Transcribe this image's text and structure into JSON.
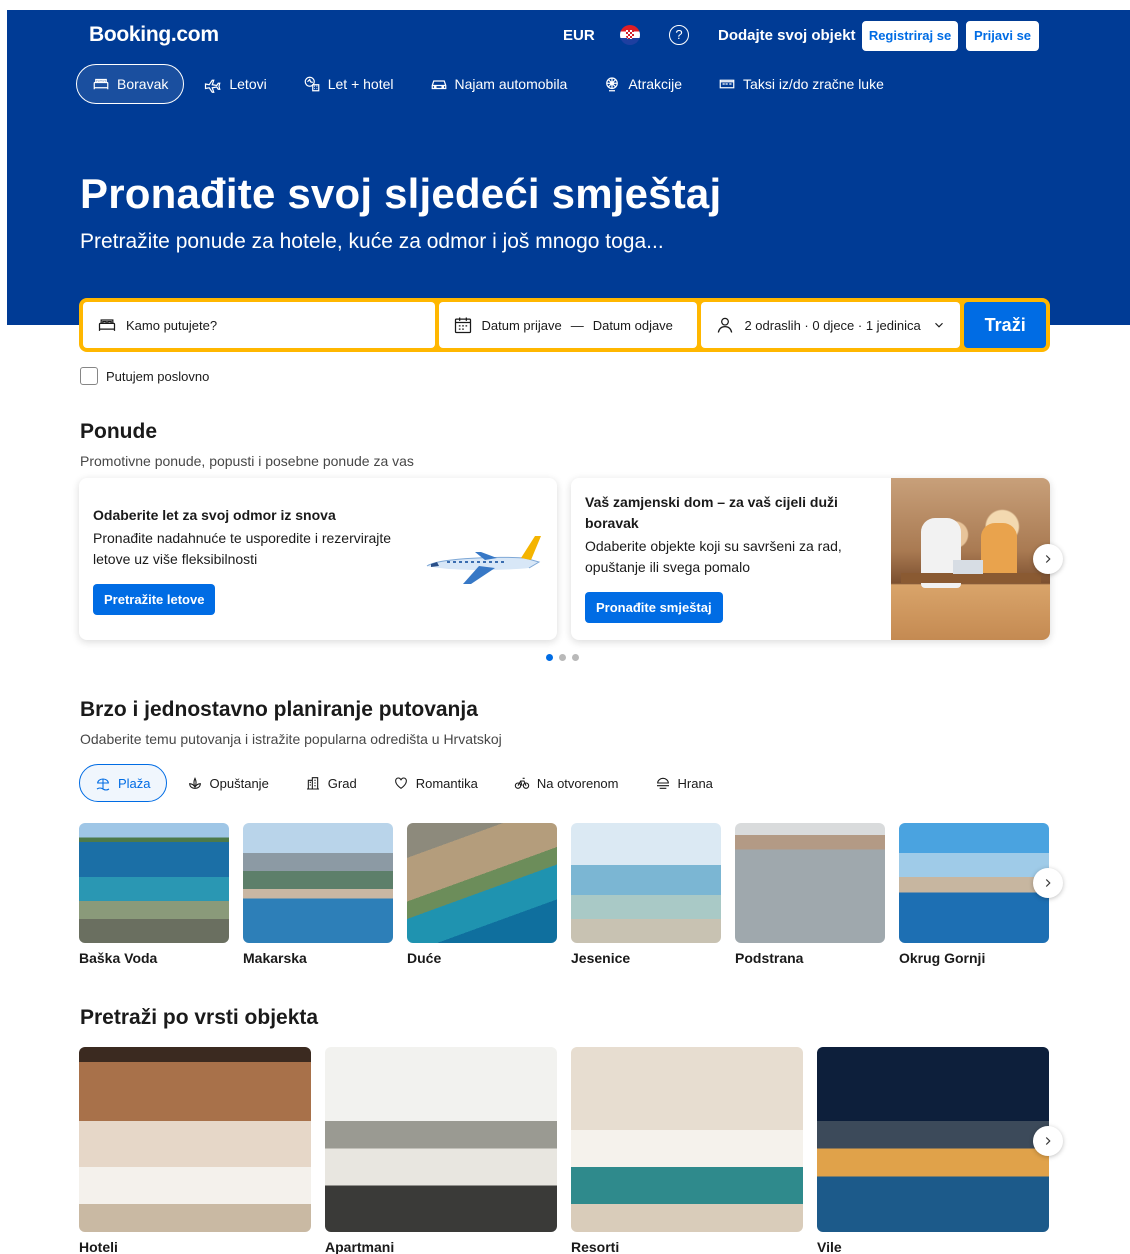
{
  "header": {
    "logo": "Booking.com",
    "currency": "EUR",
    "help": "?",
    "list_property": "Dodajte svoj objekt",
    "register": "Registriraj se",
    "login": "Prijavi se"
  },
  "nav": {
    "items": [
      {
        "label": "Boravak",
        "icon": "bed-icon",
        "active": true
      },
      {
        "label": "Letovi",
        "icon": "plane-icon"
      },
      {
        "label": "Let + hotel",
        "icon": "plane-hotel-icon"
      },
      {
        "label": "Najam automobila",
        "icon": "car-icon"
      },
      {
        "label": "Atrakcije",
        "icon": "attractions-icon"
      },
      {
        "label": "Taksi iz/do zračne luke",
        "icon": "taxi-icon"
      }
    ]
  },
  "hero": {
    "title": "Pronađite svoj sljedeći smještaj",
    "subtitle": "Pretražite ponude za hotele, kuće za odmor i još mnogo toga..."
  },
  "search": {
    "destination_placeholder": "Kamo putujete?",
    "checkin": "Datum prijave",
    "date_sep": "—",
    "checkout": "Datum odjave",
    "guests": "2 odraslih · 0 djece · 1 jedinica",
    "button": "Traži",
    "business_label": "Putujem poslovno"
  },
  "offers": {
    "title": "Ponude",
    "subtitle": "Promotivne ponude, popusti i posebne ponude za vas",
    "cards": [
      {
        "title": "Odaberite let za svoj odmor iz snova",
        "text": "Pronađite nadahnuće te usporedite i rezervirajte letove uz više fleksibilnosti",
        "button": "Pretražite letove"
      },
      {
        "title": "Vaš zamjenski dom – za vaš cijeli duži boravak",
        "text": "Odaberite objekte koji su savršeni za rad, opuštanje ili svega pomalo",
        "button": "Pronađite smještaj"
      }
    ]
  },
  "planning": {
    "title": "Brzo i jednostavno planiranje putovanja",
    "subtitle": "Odaberite temu putovanja i istražite popularna odredišta u Hrvatskoj",
    "chips": [
      {
        "label": "Plaža",
        "icon": "beach-icon",
        "active": true
      },
      {
        "label": "Opuštanje",
        "icon": "relax-icon"
      },
      {
        "label": "Grad",
        "icon": "city-icon"
      },
      {
        "label": "Romantika",
        "icon": "heart-icon"
      },
      {
        "label": "Na otvorenom",
        "icon": "bike-icon"
      },
      {
        "label": "Hrana",
        "icon": "food-icon"
      }
    ],
    "destinations": [
      "Baška Voda",
      "Makarska",
      "Duće",
      "Jesenice",
      "Podstrana",
      "Okrug Gornji"
    ]
  },
  "property_types": {
    "title": "Pretraži po vrsti objekta",
    "items": [
      "Hoteli",
      "Apartmani",
      "Resorti",
      "Vile"
    ]
  },
  "colors": {
    "brand_blue": "#003b95",
    "action_blue": "#006ce4",
    "search_border": "#ffb700"
  }
}
